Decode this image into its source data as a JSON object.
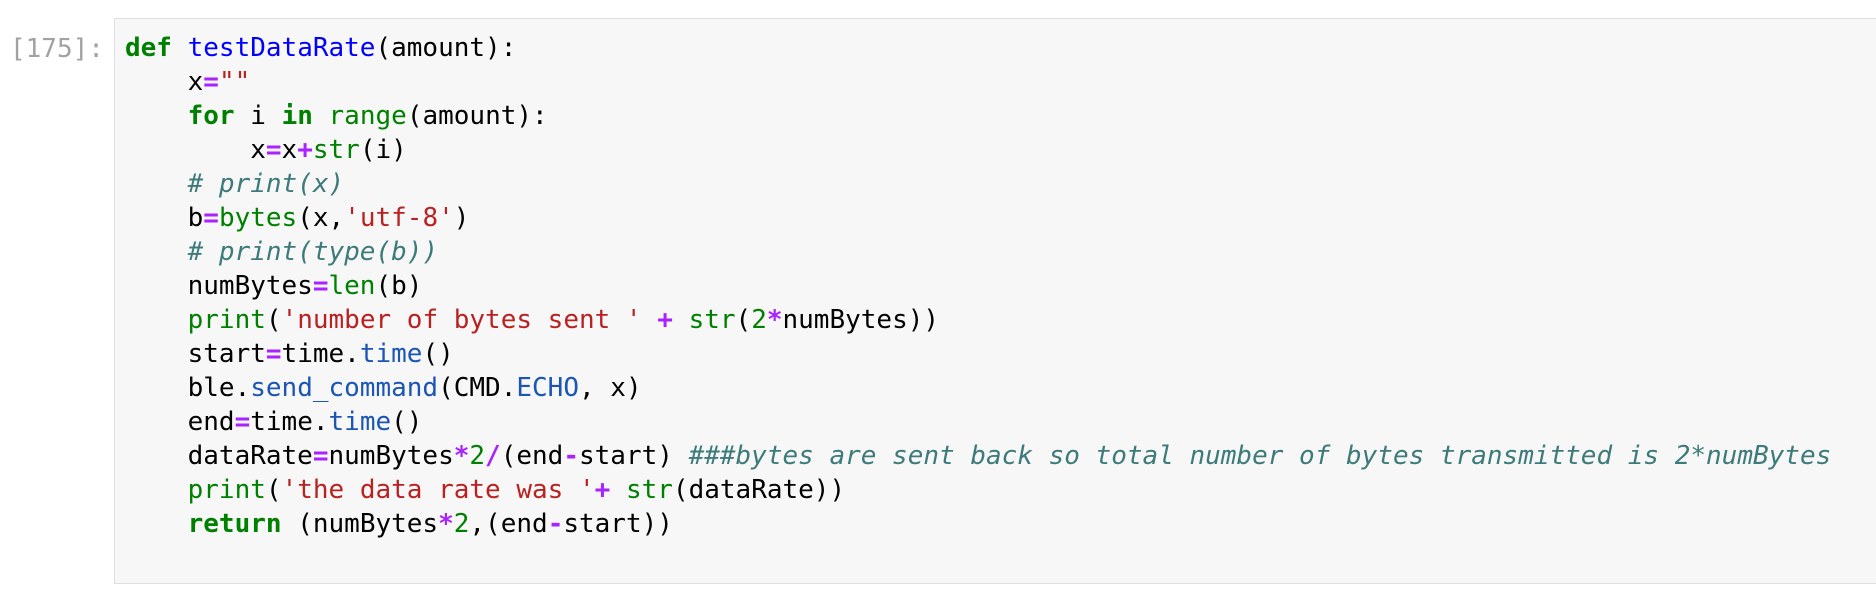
{
  "cell": {
    "execution_count": "[175]:",
    "lines": [
      [
        [
          "kw",
          "def"
        ],
        [
          "",
          ""
        ],
        [
          "def",
          " testDataRate"
        ],
        [
          "",
          "(amount):"
        ]
      ],
      [
        [
          "",
          "    x"
        ],
        [
          "op",
          "="
        ],
        [
          "str",
          "\"\""
        ]
      ],
      [
        [
          "",
          "    "
        ],
        [
          "kw",
          "for"
        ],
        [
          "",
          " i "
        ],
        [
          "kw",
          "in"
        ],
        [
          "",
          " "
        ],
        [
          "bi",
          "range"
        ],
        [
          "",
          "(amount):"
        ]
      ],
      [
        [
          "",
          "        x"
        ],
        [
          "op",
          "="
        ],
        [
          "",
          "x"
        ],
        [
          "op",
          "+"
        ],
        [
          "bi",
          "str"
        ],
        [
          "",
          "(i)"
        ]
      ],
      [
        [
          "",
          "    "
        ],
        [
          "cm",
          "# print(x)"
        ]
      ],
      [
        [
          "",
          "    b"
        ],
        [
          "op",
          "="
        ],
        [
          "bi",
          "bytes"
        ],
        [
          "",
          "(x,"
        ],
        [
          "str",
          "'utf-8'"
        ],
        [
          "",
          ")"
        ]
      ],
      [
        [
          "",
          "    "
        ],
        [
          "cm",
          "# print(type(b))"
        ]
      ],
      [
        [
          "",
          "    numBytes"
        ],
        [
          "op",
          "="
        ],
        [
          "bi",
          "len"
        ],
        [
          "",
          "(b)"
        ]
      ],
      [
        [
          "",
          "    "
        ],
        [
          "bi",
          "print"
        ],
        [
          "",
          "("
        ],
        [
          "str",
          "'number of bytes sent '"
        ],
        [
          "",
          " "
        ],
        [
          "op",
          "+"
        ],
        [
          "",
          " "
        ],
        [
          "bi",
          "str"
        ],
        [
          "",
          "("
        ],
        [
          "num",
          "2"
        ],
        [
          "op",
          "*"
        ],
        [
          "",
          "numBytes))"
        ]
      ],
      [
        [
          "",
          "    start"
        ],
        [
          "op",
          "="
        ],
        [
          "",
          "time."
        ],
        [
          "attr",
          "time"
        ],
        [
          "",
          "()"
        ]
      ],
      [
        [
          "",
          "    ble."
        ],
        [
          "attr",
          "send_command"
        ],
        [
          "",
          "(CMD."
        ],
        [
          "attr",
          "ECHO"
        ],
        [
          "",
          ", x)"
        ]
      ],
      [
        [
          "",
          "    end"
        ],
        [
          "op",
          "="
        ],
        [
          "",
          "time."
        ],
        [
          "attr",
          "time"
        ],
        [
          "",
          "()"
        ]
      ],
      [
        [
          "",
          "    dataRate"
        ],
        [
          "op",
          "="
        ],
        [
          "",
          "numBytes"
        ],
        [
          "op",
          "*"
        ],
        [
          "num",
          "2"
        ],
        [
          "op",
          "/"
        ],
        [
          "",
          "(end"
        ],
        [
          "op",
          "-"
        ],
        [
          "",
          "start) "
        ],
        [
          "cm",
          "###bytes are sent back so total number of bytes transmitted is 2*numBytes"
        ]
      ],
      [
        [
          "",
          "    "
        ],
        [
          "bi",
          "print"
        ],
        [
          "",
          "("
        ],
        [
          "str",
          "'the data rate was '"
        ],
        [
          "op",
          "+"
        ],
        [
          "",
          " "
        ],
        [
          "bi",
          "str"
        ],
        [
          "",
          "(dataRate))"
        ]
      ],
      [
        [
          "",
          "    "
        ],
        [
          "kw",
          "return"
        ],
        [
          "",
          " (numBytes"
        ],
        [
          "op",
          "*"
        ],
        [
          "num",
          "2"
        ],
        [
          "",
          ",(end"
        ],
        [
          "op",
          "-"
        ],
        [
          "",
          "start))"
        ]
      ]
    ]
  },
  "colors": {
    "keyword": "#008000",
    "function_name": "#0000ff",
    "builtin": "#008000",
    "attribute": "#1b55b5",
    "string": "#ba2121",
    "operator": "#aa22ff",
    "comment": "#3d7b7b",
    "cell_background": "#f7f7f7",
    "prompt": "#a2a2a2"
  }
}
